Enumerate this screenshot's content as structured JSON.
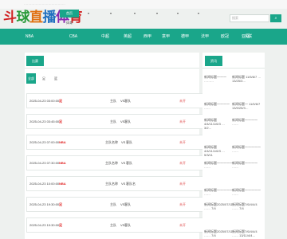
{
  "topbar": {
    "text": "·······································"
  },
  "logo": {
    "chars": [
      "斗",
      "球",
      "直",
      "播",
      "体",
      "育"
    ]
  },
  "header_nav": {
    "tabs": [
      {
        "label": "首页",
        "active": true
      },
      {
        "label": "▾",
        "active": false
      },
      {
        "label": "▾",
        "active": false
      },
      {
        "label": "▾",
        "active": false
      },
      {
        "label": "▾",
        "active": false
      },
      {
        "label": "▾",
        "active": false
      },
      {
        "label": "▾",
        "active": false
      }
    ],
    "sub_label": "体育"
  },
  "search": {
    "placeholder": "搜索",
    "button": "⌕"
  },
  "main_nav": {
    "items": [
      "NBA",
      "CBA",
      "中超",
      "英超",
      "西甲",
      "意甲",
      "德甲",
      "法甲",
      "欧冠",
      "亚冠",
      "K联"
    ]
  },
  "schedule": {
    "title": "比赛",
    "filters": [
      "全部",
      "足",
      "篮"
    ],
    "rows": [
      {
        "time": "2025-04-23 03:00:00",
        "league": "足",
        "home": "主队",
        "vs": "VS",
        "away": "客队",
        "status": "未开"
      },
      {
        "time": "2025-04-23 03:45:00",
        "league": "足",
        "home": "主队",
        "vs": "VS",
        "away": "客队",
        "status": "未开"
      },
      {
        "time": "2025-04-23 07:00:00",
        "league": "NBA",
        "home": "主队名称",
        "vs": "VS",
        "away": "客队",
        "status": "未开"
      },
      {
        "time": "2025-04-23 07:30:00",
        "league": "NBA",
        "home": "主队名称",
        "vs": "VS",
        "away": "客队",
        "status": "未开"
      },
      {
        "time": "2025-04-23 10:00:00",
        "league": "NBA",
        "home": "主队名称",
        "vs": "VS",
        "away": "客队名",
        "status": "未开"
      },
      {
        "time": "2025-04-23 19:30:00",
        "league": "足",
        "home": "主队",
        "vs": "VS",
        "away": "客队",
        "status": "未开"
      },
      {
        "time": "2025-04-23 19:30:00",
        "league": "足",
        "home": "主队",
        "vs": "VS",
        "away": "客队",
        "status": "未开"
      }
    ]
  },
  "sidebar": {
    "title": "资讯",
    "news": [
      "新闻标题一一一 ………",
      "新闻标题 11/5/6/7 …  13/25/3…",
      "新闻标题一一一一 ……",
      "新闻标题一 11/5/6/7 13/9/25/3…",
      "新闻标题4/4/11/1/6/3 … 3/2…",
      "新闻标题一一一一 ……",
      "新闻标题4/4/11/1/6/3 … 5/3/11",
      "新闻标题一一一一一 ……",
      "新闻标题一一一一一 ……",
      "新闻标题一一一一 ……",
      "新闻标题一一一一一 ……",
      "新闻标题一一一一一 ……",
      "新闻标题2025/07/11 …… 7/4",
      "新闻标题7/6/4/4/4 …… 7/4",
      "新闻标题2025/07/11 …… 7/4",
      "新闻标题7/6/4/4/4 …… 13/11/4/4…"
    ]
  }
}
